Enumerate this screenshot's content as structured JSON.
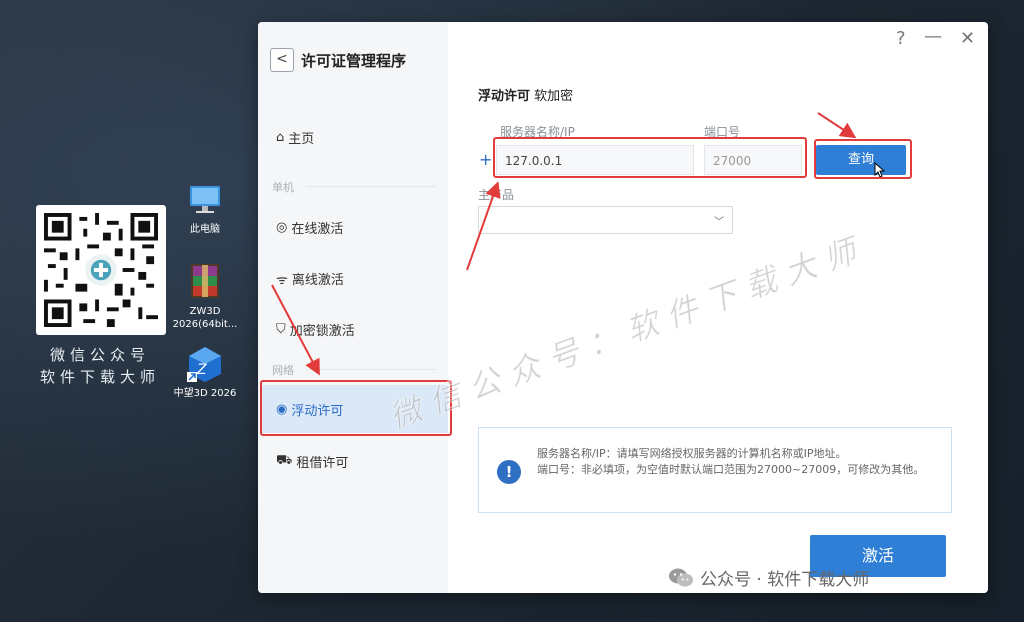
{
  "desktop": {
    "qr_caption_line1": "微信公众号",
    "qr_caption_line2": "软件下载大师",
    "icons": [
      {
        "name": "this-pc",
        "label": "此电脑"
      },
      {
        "name": "zw3d-archive",
        "label": "ZW3D 2026(64bit..."
      },
      {
        "name": "zw3d-app",
        "label": "中望3D 2026"
      }
    ]
  },
  "window": {
    "title": "许可证管理程序",
    "back_label": "<",
    "controls": {
      "help": "?",
      "minimize": "—",
      "close": "✕"
    },
    "sidebar": {
      "home": "主页",
      "group_single": "单机",
      "online": "在线激活",
      "offline": "离线激活",
      "dongle": "加密锁激活",
      "group_network": "网络",
      "floating": "浮动许可",
      "lease": "租借许可"
    },
    "main": {
      "heading_bold": "浮动许可",
      "heading_sub": "软加密",
      "server_label": "服务器名称/IP",
      "port_label": "端口号",
      "server_value": "127.0.0.1",
      "port_placeholder": "27000",
      "query_button": "查询",
      "product_label": "主产品",
      "product_value": "",
      "info_line1": "服务器名称/IP：请填写网络授权服务器的计算机名称或IP地址。",
      "info_line2": "端口号：非必填项，为空值时默认端口范围为27000~27009，可修改为其他。",
      "activate_button": "激活"
    }
  },
  "overlays": {
    "watermark": "微信公众号：软件下载大师",
    "wechat_tag": "公众号 · 软件下载大师"
  },
  "colors": {
    "accent": "#2f7fd6",
    "highlight_box": "#e23b3b",
    "active_nav_bg": "#dbe8f7"
  }
}
